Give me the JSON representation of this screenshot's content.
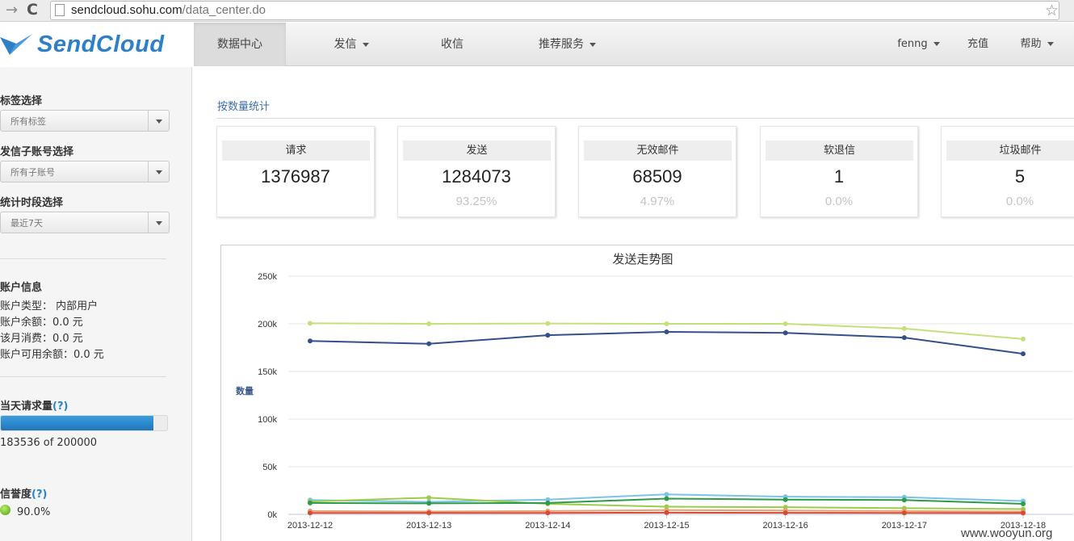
{
  "browser": {
    "url_host": "sendcloud.sohu.com",
    "url_path": "/data_center.do"
  },
  "logo": {
    "text": "SendCloud"
  },
  "nav": {
    "items": [
      {
        "label": "数据中心",
        "active": true
      },
      {
        "label": "发信"
      },
      {
        "label": "收信"
      },
      {
        "label": "推荐服务"
      }
    ],
    "right": [
      {
        "label": "fenng"
      },
      {
        "label": "充值"
      },
      {
        "label": "帮助"
      }
    ]
  },
  "sidebar": {
    "tag_label": "标签选择",
    "tag_value": "所有标签",
    "subaccount_label": "发信子账号选择",
    "subaccount_value": "所有子账号",
    "period_label": "统计时段选择",
    "period_value": "最近7天",
    "account_title": "账户信息",
    "account_type": "账户类型： 内部用户",
    "balance": "账户余额：0.0 元",
    "monthly_spend": "该月消费：0.0 元",
    "available_balance": "账户可用余额：0.0 元",
    "daily_title": "当天请求量",
    "help_mark": "(?)",
    "daily_text": "183536 of 200000",
    "daily_progress": 0.918,
    "reputation_title": "信誉度",
    "reputation_value": "90.0%"
  },
  "main": {
    "section_title": "按数量统计",
    "cards": [
      {
        "label": "请求",
        "value": "1376987",
        "pct": ""
      },
      {
        "label": "发送",
        "value": "1284073",
        "pct": "93.25%"
      },
      {
        "label": "无效邮件",
        "value": "68509",
        "pct": "4.97%"
      },
      {
        "label": "软退信",
        "value": "1",
        "pct": "0.0%"
      },
      {
        "label": "垃圾邮件",
        "value": "5",
        "pct": "0.0%"
      }
    ]
  },
  "chart_data": {
    "type": "line",
    "title": "发送走势图",
    "ylabel": "数量",
    "xlabel": "",
    "ylim": [
      0,
      250000
    ],
    "yticks": [
      "0k",
      "50k",
      "100k",
      "150k",
      "200k",
      "250k"
    ],
    "categories": [
      "2013-12-12",
      "2013-12-13",
      "2013-12-14",
      "2013-12-15",
      "2013-12-16",
      "2013-12-17",
      "2013-12-18"
    ],
    "grid": true,
    "series": [
      {
        "color": "#c5e07a",
        "values": [
          200500,
          200000,
          200300,
          200000,
          200000,
          195000,
          184000
        ]
      },
      {
        "color": "#34508a",
        "values": [
          182000,
          179000,
          188000,
          191500,
          190500,
          185500,
          168500
        ]
      },
      {
        "color": "#7cc3e6",
        "values": [
          15000,
          13000,
          15500,
          21000,
          18500,
          18000,
          14000
        ]
      },
      {
        "color": "#9ccc4a",
        "values": [
          13500,
          17500,
          11000,
          8000,
          7500,
          6500,
          5500
        ]
      },
      {
        "color": "#2e9a4a",
        "values": [
          12000,
          11500,
          12000,
          16500,
          15500,
          15000,
          11000
        ]
      },
      {
        "color": "#e8a070",
        "values": [
          3500,
          3000,
          3500,
          4500,
          4000,
          3500,
          3000
        ]
      },
      {
        "color": "#d94a34",
        "values": [
          1500,
          1500,
          1500,
          1800,
          1600,
          1500,
          1400
        ]
      }
    ]
  },
  "watermark": "www.wooyun.org",
  "colors": {
    "accent": "#2d7fc8",
    "link": "#3d6fa8",
    "progress": "#2a84c9"
  }
}
